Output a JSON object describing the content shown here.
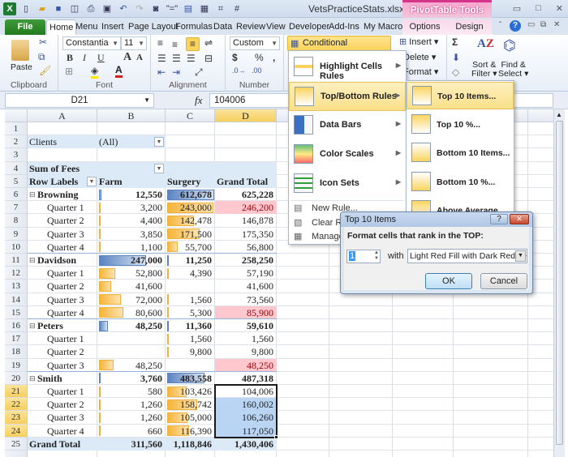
{
  "window": {
    "title": "VetsPracticeStats.xlsx - Mi...",
    "context_tab_group": "PivotTable Tools"
  },
  "tabs": [
    "File",
    "Home",
    "Menu",
    "Insert",
    "Page Layout",
    "Formulas",
    "Data",
    "Review",
    "View",
    "Developer",
    "Add-Ins",
    "My Macros",
    "Options",
    "Design"
  ],
  "ribbon": {
    "clipboard": {
      "label": "Clipboard",
      "paste": "Paste"
    },
    "font": {
      "label": "Font",
      "name": "Constantia",
      "size": "11",
      "bold": "B",
      "italic": "I",
      "underline": "U"
    },
    "alignment": {
      "label": "Alignment"
    },
    "number": {
      "label": "Number",
      "format": "Custom",
      "currency": "$",
      "percent": "%",
      "comma": ","
    },
    "styles": {
      "conditional_formatting": "Conditional Formatting"
    },
    "cells": {
      "insert": "Insert",
      "delete": "Delete",
      "format": "Format"
    },
    "editing": {
      "sum": "Σ",
      "sort_filter": "Sort &",
      "sort_filter2": "Filter",
      "find_select": "Find &",
      "find_select2": "Select"
    }
  },
  "formula_bar": {
    "name_box": "D21",
    "fx": "fx",
    "value": "104006"
  },
  "columns": [
    "A",
    "B",
    "C",
    "D"
  ],
  "rows": [
    "1",
    "2",
    "3",
    "4",
    "5",
    "6",
    "7",
    "8",
    "9",
    "10",
    "11",
    "12",
    "13",
    "14",
    "15",
    "16",
    "17",
    "18",
    "19",
    "20",
    "21",
    "22",
    "23",
    "24",
    "25"
  ],
  "pivot": {
    "filter_label": "Clients",
    "filter_value": "(All)",
    "values_label": "Sum of Fees",
    "row_labels": "Row Labels",
    "col_farm": "Farm",
    "col_surgery": "Surgery",
    "col_total": "Grand Total",
    "data": [
      {
        "label": "Browning",
        "farm": "12,550",
        "surgery": "612,678",
        "total": "625,228",
        "group": true
      },
      {
        "label": "Quarter 1",
        "farm": "3,200",
        "surgery": "243,000",
        "total": "246,200"
      },
      {
        "label": "Quarter 2",
        "farm": "4,400",
        "surgery": "142,478",
        "total": "146,878"
      },
      {
        "label": "Quarter 3",
        "farm": "3,850",
        "surgery": "171,500",
        "total": "175,350"
      },
      {
        "label": "Quarter 4",
        "farm": "1,100",
        "surgery": "55,700",
        "total": "56,800"
      },
      {
        "label": "Davidson",
        "farm": "247,000",
        "surgery": "11,250",
        "total": "258,250",
        "group": true
      },
      {
        "label": "Quarter 1",
        "farm": "52,800",
        "surgery": "4,390",
        "total": "57,190"
      },
      {
        "label": "Quarter 2",
        "farm": "41,600",
        "surgery": "",
        "total": "41,600"
      },
      {
        "label": "Quarter 3",
        "farm": "72,000",
        "surgery": "1,560",
        "total": "73,560"
      },
      {
        "label": "Quarter 4",
        "farm": "80,600",
        "surgery": "5,300",
        "total": "85,900"
      },
      {
        "label": "Peters",
        "farm": "48,250",
        "surgery": "11,360",
        "total": "59,610",
        "group": true
      },
      {
        "label": "Quarter 1",
        "farm": "",
        "surgery": "1,560",
        "total": "1,560"
      },
      {
        "label": "Quarter 2",
        "farm": "",
        "surgery": "9,800",
        "total": "9,800"
      },
      {
        "label": "Quarter 3",
        "farm": "48,250",
        "surgery": "",
        "total": "48,250"
      },
      {
        "label": "Smith",
        "farm": "3,760",
        "surgery": "483,558",
        "total": "487,318",
        "group": true
      },
      {
        "label": "Quarter 1",
        "farm": "580",
        "surgery": "103,426",
        "total": "104,006"
      },
      {
        "label": "Quarter 2",
        "farm": "1,260",
        "surgery": "158,742",
        "total": "160,002"
      },
      {
        "label": "Quarter 3",
        "farm": "1,260",
        "surgery": "105,000",
        "total": "106,260"
      },
      {
        "label": "Quarter 4",
        "farm": "660",
        "surgery": "116,390",
        "total": "117,050"
      }
    ],
    "grand_total": {
      "label": "Grand Total",
      "farm": "311,560",
      "surgery": "1,118,846",
      "total": "1,430,406"
    }
  },
  "cf_menu": {
    "items": [
      "Highlight Cells Rules",
      "Top/Bottom Rules",
      "Data Bars",
      "Color Scales",
      "Icon Sets"
    ],
    "small_items": [
      "New Rule...",
      "Clear Rules",
      "Manage Rules..."
    ]
  },
  "submenu": {
    "items": [
      "Top 10 Items...",
      "Top 10 %...",
      "Bottom 10 Items...",
      "Bottom 10 %...",
      "Above Average"
    ]
  },
  "dialog": {
    "title": "Top 10 Items",
    "prompt": "Format cells that rank in the TOP:",
    "count": "1",
    "with": "with",
    "format": "Light Red Fill with Dark Red Text",
    "ok": "OK",
    "cancel": "Cancel",
    "help": "?",
    "close": "✕"
  }
}
